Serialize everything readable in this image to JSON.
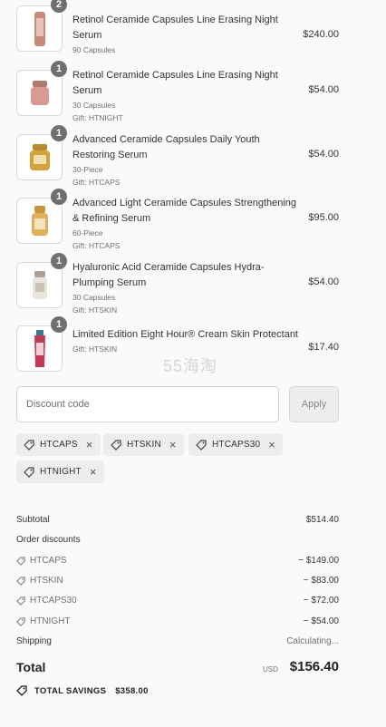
{
  "items": [
    {
      "qty": "2",
      "name": "Retinol Ceramide Capsules Line Erasing Night Serum",
      "details": [
        "90 Capsules"
      ],
      "price": "$240.00",
      "color": "#c98a7a"
    },
    {
      "qty": "1",
      "name": "Retinol Ceramide Capsules Line Erasing Night Serum",
      "details": [
        "30 Capsules",
        "Gift: HTNIGHT"
      ],
      "price": "$54.00",
      "color": "#d89b92"
    },
    {
      "qty": "1",
      "name": "Advanced Ceramide Capsules Daily Youth Restoring Serum",
      "details": [
        "30-Piece",
        "Gift: HTCAPS"
      ],
      "price": "$54.00",
      "color": "#d2a23c"
    },
    {
      "qty": "1",
      "name": "Advanced Light Ceramide Capsules Strengthening & Refining Serum",
      "details": [
        "60-Piece",
        "Gift: HTCAPS"
      ],
      "price": "$95.00",
      "color": "#e0b15c"
    },
    {
      "qty": "1",
      "name": "Hyaluronic Acid Ceramide Capsules Hydra-Plumping Serum",
      "details": [
        "30 Capsules",
        "Gift: HTSKIN"
      ],
      "price": "$54.00",
      "color": "#c9c1b4"
    },
    {
      "qty": "1",
      "name": "Limited Edition Eight Hour® Cream Skin Protectant",
      "details": [
        "Gift: HTSKIN"
      ],
      "price": "$17.40",
      "color": "#c23b55"
    }
  ],
  "discount": {
    "placeholder": "Discount code",
    "apply_label": "Apply"
  },
  "applied_codes": [
    "HTCAPS",
    "HTSKIN",
    "HTCAPS30",
    "HTNIGHT"
  ],
  "summary": {
    "subtotal_label": "Subtotal",
    "subtotal": "$514.40",
    "order_discounts_label": "Order discounts",
    "discounts": [
      {
        "code": "HTCAPS",
        "amount": "− $149.00"
      },
      {
        "code": "HTSKIN",
        "amount": "− $83.00"
      },
      {
        "code": "HTCAPS30",
        "amount": "− $72.00"
      },
      {
        "code": "HTNIGHT",
        "amount": "− $54.00"
      }
    ],
    "shipping_label": "Shipping",
    "shipping_value": "Calculating...",
    "total_label": "Total",
    "currency": "USD",
    "total": "$156.40",
    "savings_label": "TOTAL SAVINGS",
    "savings": "$358.00"
  },
  "watermark": "55海淘",
  "remove_glyph": "×"
}
